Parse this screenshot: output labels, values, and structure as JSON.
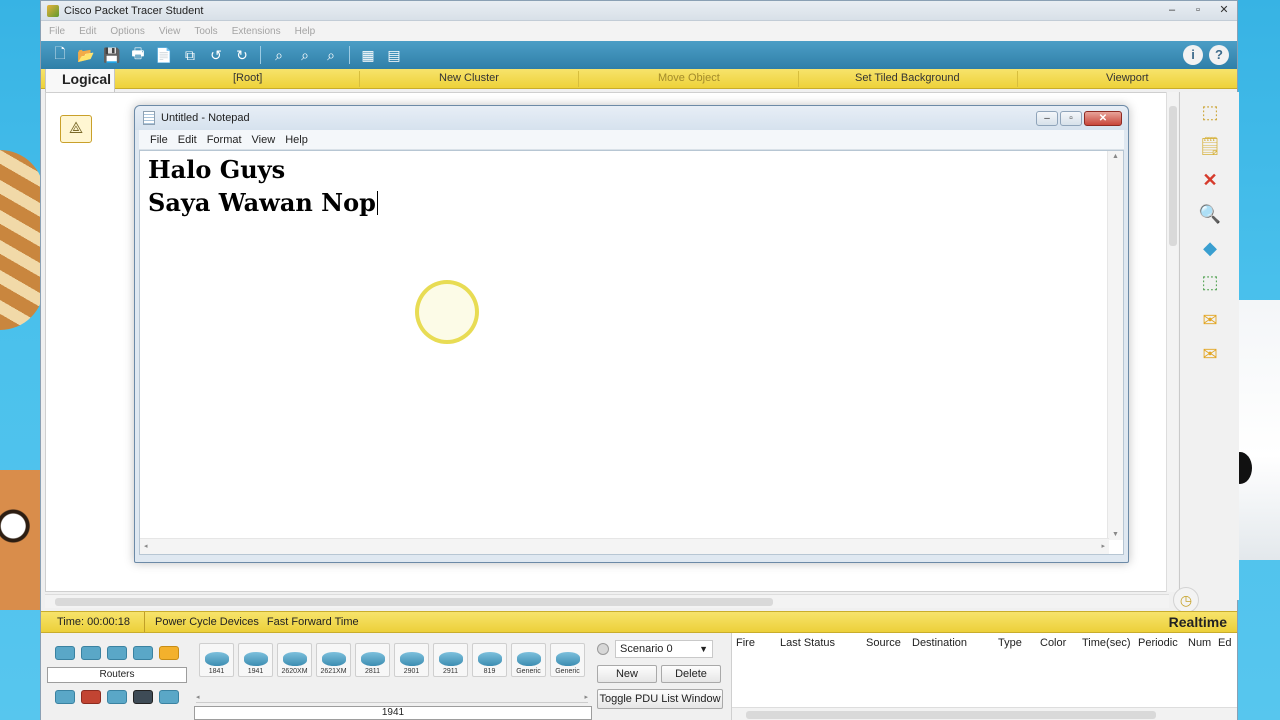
{
  "packet_tracer": {
    "title": "Cisco Packet Tracer Student",
    "window_controls": {
      "minimize": "–",
      "restore": "▫",
      "close": "✕"
    },
    "menu": [
      "File",
      "Edit",
      "Options",
      "View",
      "Tools",
      "Extensions",
      "Help"
    ],
    "toolbar_icons": [
      "new-file-icon",
      "open-folder-icon",
      "save-icon",
      "print-icon",
      "activity-wizard-icon",
      "copy-icon",
      "undo-icon",
      "redo-icon",
      "zoom-in-icon",
      "zoom-reset-icon",
      "zoom-out-icon",
      "palette-icon",
      "custom-device-icon"
    ],
    "help_icons": [
      "info-icon",
      "question-icon"
    ],
    "nav": {
      "logical": "Logical",
      "root": "[Root]",
      "new_cluster": "New Cluster",
      "move_object": "Move Object",
      "set_tiled_background": "Set Tiled Background",
      "viewport": "Viewport"
    },
    "status": {
      "time": "Time: 00:00:18",
      "power_cycle": "Power Cycle Devices",
      "fast_forward": "Fast Forward Time",
      "mode": "Realtime"
    },
    "device_category": "Routers",
    "routers": [
      "1841",
      "1941",
      "2620XM",
      "2621XM",
      "2811",
      "2901",
      "2911",
      "819",
      "Generic",
      "Generic"
    ],
    "selected_device": "1941",
    "scenario": {
      "select": "Scenario 0",
      "new": "New",
      "delete": "Delete",
      "toggle": "Toggle PDU List Window"
    },
    "pdu_columns": [
      "Fire",
      "Last Status",
      "Source",
      "Destination",
      "Type",
      "Color",
      "Time(sec)",
      "Periodic",
      "Num",
      "Ed"
    ]
  },
  "notepad": {
    "title": "Untitled - Notepad",
    "menu": [
      "File",
      "Edit",
      "Format",
      "View",
      "Help"
    ],
    "lines": [
      "Halo Guys",
      "Saya Wawan Nop"
    ]
  },
  "colors": {
    "toolbar_blue": "#2f7fa8",
    "nav_yellow": "#eed23a",
    "cursor_highlight": "#e4d63a"
  }
}
